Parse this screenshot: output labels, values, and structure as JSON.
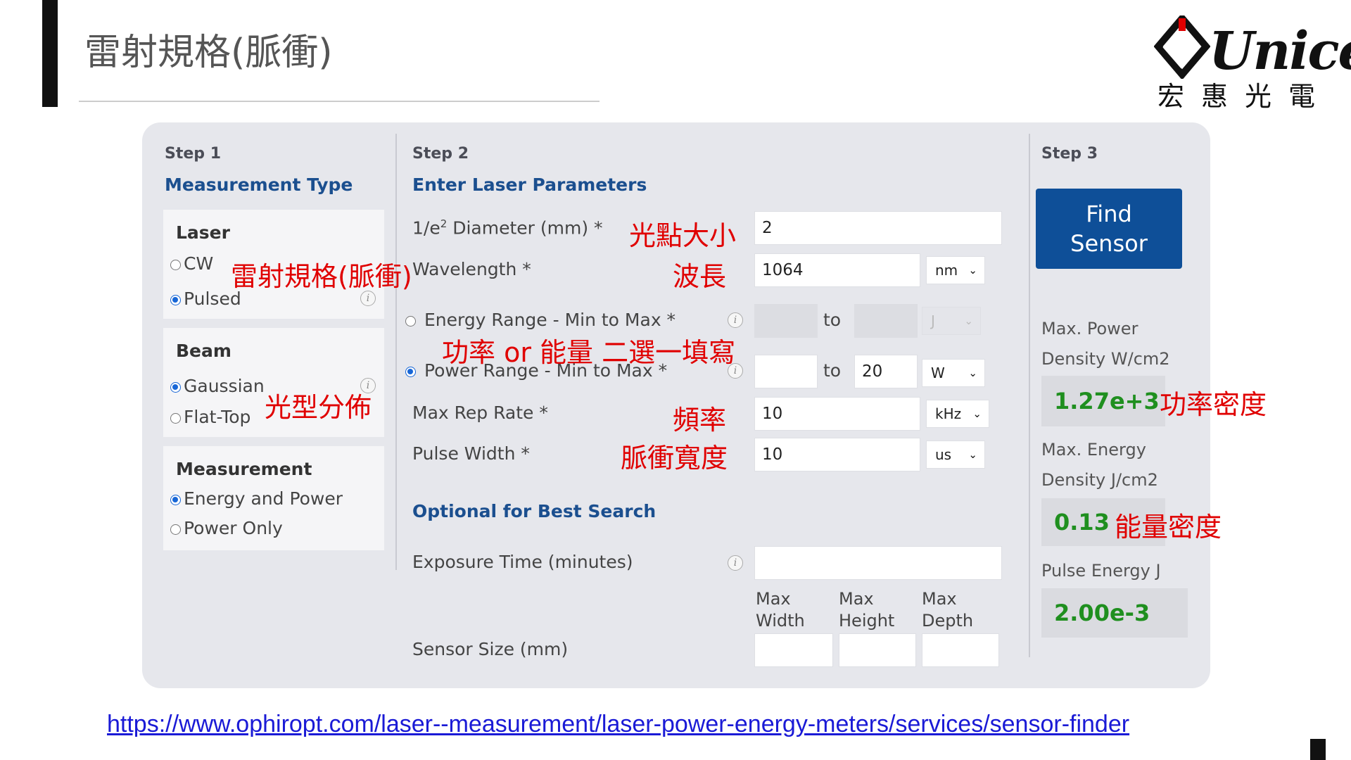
{
  "slide": {
    "title": "雷射規格(脈衝)",
    "logo_brand": "Unice",
    "logo_subtitle": "宏惠光電",
    "url": "https://www.ophiropt.com/laser--measurement/laser-power-energy-meters/services/sensor-finder"
  },
  "step1": {
    "step_label": "Step 1",
    "heading": "Measurement Type",
    "laser": {
      "title": "Laser",
      "options": [
        "CW",
        "Pulsed"
      ],
      "selected": "Pulsed"
    },
    "beam": {
      "title": "Beam",
      "options": [
        "Gaussian",
        "Flat-Top"
      ],
      "selected": "Gaussian"
    },
    "measurement": {
      "title": "Measurement",
      "options": [
        "Energy and Power",
        "Power Only"
      ],
      "selected": "Energy and Power"
    }
  },
  "step2": {
    "step_label": "Step 2",
    "heading": "Enter Laser Parameters",
    "diameter": {
      "label_pre": "1/e",
      "label_sup": "2",
      "label_post": " Diameter (mm) *",
      "value": "2"
    },
    "wavelength": {
      "label": "Wavelength *",
      "value": "1064",
      "unit": "nm"
    },
    "energy_range": {
      "label": "Energy Range - Min to Max *",
      "min": "",
      "max": "",
      "to": "to",
      "unit": "J",
      "selected": false
    },
    "power_range": {
      "label": "Power Range - Min to Max *",
      "min": "",
      "max": "20",
      "to": "to",
      "unit": "W",
      "selected": true
    },
    "rep_rate": {
      "label": "Max Rep Rate *",
      "value": "10",
      "unit": "kHz"
    },
    "pulse_width": {
      "label": "Pulse Width *",
      "value": "10",
      "unit": "us"
    },
    "optional_heading": "Optional for Best Search",
    "exposure": {
      "label": "Exposure Time (minutes)",
      "value": ""
    },
    "sensor_size": {
      "label": "Sensor Size (mm)",
      "columns": [
        [
          "Max",
          "Width"
        ],
        [
          "Max",
          "Height"
        ],
        [
          "Max",
          "Depth"
        ]
      ],
      "values": [
        "",
        "",
        ""
      ]
    }
  },
  "step3": {
    "step_label": "Step 3",
    "button_label": [
      "Find",
      "Sensor"
    ],
    "results": [
      {
        "label": [
          "Max. Power",
          "Density W/cm2"
        ],
        "value": "1.27e+3"
      },
      {
        "label": [
          "Max. Energy",
          "Density J/cm2"
        ],
        "value": "0.13"
      },
      {
        "label": [
          "Pulse Energy J"
        ],
        "value": "2.00e-3"
      }
    ]
  },
  "annotations": {
    "laser_spec": "雷射規格(脈衝)",
    "beam_shape": "光型分佈",
    "spot_size": "光點大小",
    "wavelength": "波長",
    "power_or_energy": "功率 or 能量 二選一填寫",
    "frequency": "頻率",
    "pulse_width": "脈衝寬度",
    "power_density": "功率密度",
    "energy_density": "能量密度"
  },
  "colors": {
    "accent": "#1b4f8f",
    "button": "#0e4f98",
    "result_green": "#1f8f1f",
    "annotation_red": "#e00000",
    "panel_bg": "#e6e7ec"
  }
}
